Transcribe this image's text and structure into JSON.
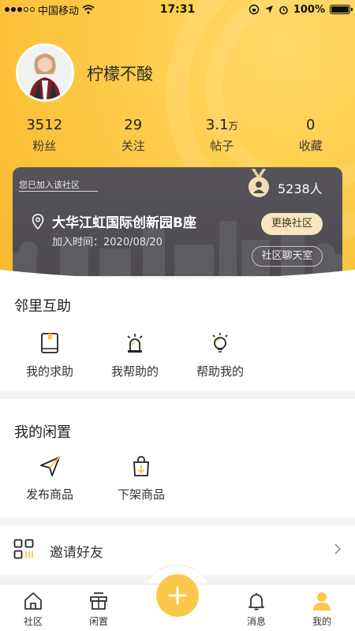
{
  "status_bar": {
    "carrier": "中国移动",
    "time": "17:31",
    "battery": "100%",
    "battery_level": 1.0
  },
  "profile": {
    "username": "柠檬不酸"
  },
  "stats": [
    {
      "value": "3512",
      "unit": "",
      "label": "粉丝"
    },
    {
      "value": "29",
      "unit": "",
      "label": "关注"
    },
    {
      "value": "3.1",
      "unit": "万",
      "label": "帖子"
    },
    {
      "value": "0",
      "unit": "",
      "label": "收藏"
    }
  ],
  "community_card": {
    "joined_text": "您已加入该社区",
    "member_count": "5238人",
    "community_name": "大华江虹国际创新园B座",
    "join_time": "加入时间：2020/08/20",
    "change_button": "更换社区",
    "chat_button": "社区聊天室"
  },
  "neighbor_help": {
    "title": "邻里互助",
    "items": [
      {
        "label": "我的求助",
        "icon": "book-icon"
      },
      {
        "label": "我帮助的",
        "icon": "alarm-light-icon"
      },
      {
        "label": "帮助我的",
        "icon": "lightbulb-icon"
      }
    ]
  },
  "my_idle": {
    "title": "我的闲置",
    "items": [
      {
        "label": "发布商品",
        "icon": "send-icon"
      },
      {
        "label": "下架商品",
        "icon": "bag-down-icon"
      }
    ]
  },
  "invite": {
    "label": "邀请好友",
    "icon": "qr-code-icon"
  },
  "tab_bar": {
    "tabs": [
      {
        "label": "社区",
        "icon": "home-icon"
      },
      {
        "label": "闲置",
        "icon": "gift-box-icon"
      },
      {
        "label": "消息",
        "icon": "bell-icon"
      },
      {
        "label": "我的",
        "icon": "user-icon"
      }
    ],
    "fab_icon": "plus-icon",
    "active_tab": "我的"
  },
  "colors": {
    "accent": "#fcc84a",
    "card": "#524e55",
    "button_cream": "#f6e6c2"
  }
}
